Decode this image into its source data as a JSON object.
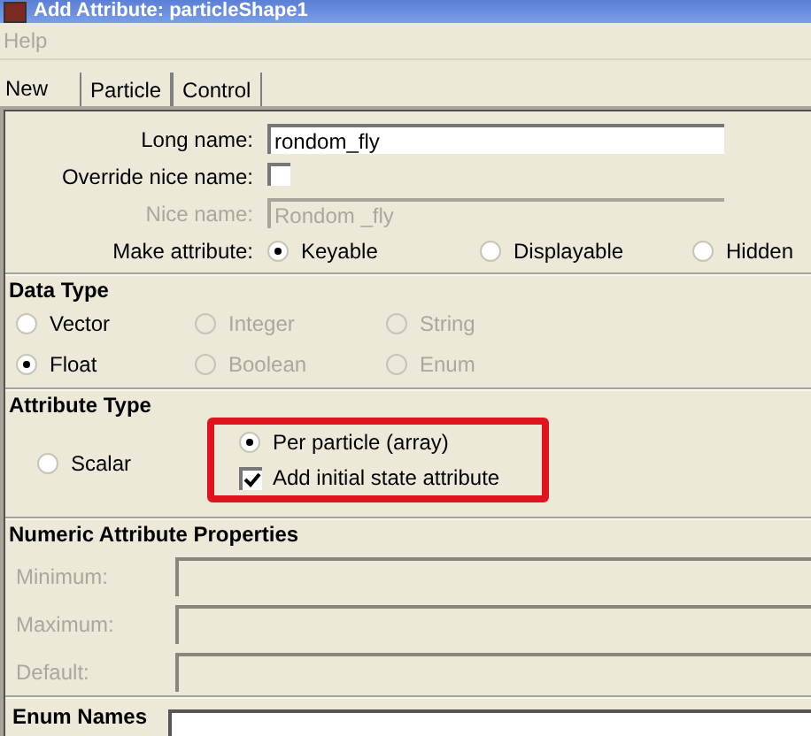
{
  "window": {
    "title": "Add Attribute: particleShape1"
  },
  "menu": [
    {
      "label": "Help",
      "disabled": true
    }
  ],
  "tabs": [
    {
      "label": "New",
      "selected": true
    },
    {
      "label": "Particle",
      "selected": false
    },
    {
      "label": "Control",
      "selected": false
    }
  ],
  "fields": [
    {
      "kind": "text",
      "label": "Long name:",
      "value": "rondom_fly",
      "disabled": false
    },
    {
      "kind": "checkbox",
      "label": "Override nice name:",
      "checked": false
    },
    {
      "kind": "text",
      "label": "Nice name:",
      "value": "Rondom _fly",
      "disabled": true
    },
    {
      "kind": "radio",
      "label": "Make attribute:",
      "options": [
        {
          "label": "Keyable",
          "selected": true
        },
        {
          "label": "Displayable",
          "selected": false
        },
        {
          "label": "Hidden",
          "selected": false
        }
      ]
    }
  ],
  "data_type": {
    "title": "Data Type",
    "options": [
      {
        "label": "Vector",
        "selected": false,
        "disabled": false
      },
      {
        "label": "Integer",
        "selected": false,
        "disabled": true
      },
      {
        "label": "String",
        "selected": false,
        "disabled": true
      },
      {
        "label": "Float",
        "selected": true,
        "disabled": false
      },
      {
        "label": "Boolean",
        "selected": false,
        "disabled": true
      },
      {
        "label": "Enum",
        "selected": false,
        "disabled": true
      }
    ]
  },
  "attribute_type": {
    "title": "Attribute Type",
    "highlighted": true,
    "options": [
      {
        "label": "Scalar",
        "selected": false
      },
      {
        "label": "Per particle (array)",
        "selected": true
      }
    ],
    "checkbox": {
      "label": "Add initial state attribute",
      "checked": true
    }
  },
  "numeric": {
    "title": "Numeric Attribute Properties",
    "fields": [
      {
        "label": "Minimum:",
        "disabled": true
      },
      {
        "label": "Maximum:",
        "disabled": true
      },
      {
        "label": "Default:",
        "disabled": true
      }
    ]
  },
  "enum": {
    "title": "Enum Names"
  }
}
